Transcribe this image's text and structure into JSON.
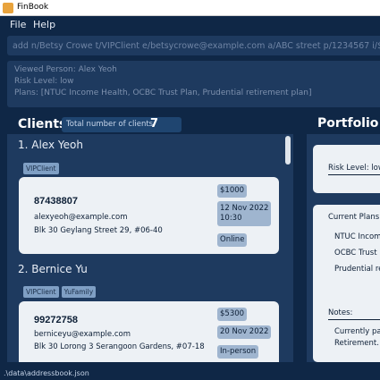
{
  "window": {
    "title": "FinBook"
  },
  "menu": {
    "file": "File",
    "help": "Help"
  },
  "command": {
    "value": "add n/Betsy Crowe t/VIPClient e/betsycrowe@example.com a/ABC street p/1234567 i/$10 m/23 Feb"
  },
  "result": {
    "lines": [
      "Viewed Person: Alex Yeoh",
      "Risk Level: low",
      "Plans: [NTUC Income Health, OCBC Trust Plan, Prudential retirement plan]"
    ]
  },
  "clients": {
    "title": "Clients",
    "count_label": "Total number of clients:",
    "count": "7",
    "items": [
      {
        "index_name": "1.  Alex Yeoh",
        "tags": [
          "VIPClient"
        ],
        "phone": "87438807",
        "email": "alexyeoh@example.com",
        "address": "Blk 30 Geylang Street 29, #06-40",
        "income": "$1000",
        "meeting": "12 Nov 2022\n10:30",
        "meeting_date": "12 Nov 2022",
        "meeting_time": "10:30",
        "mode": "Online"
      },
      {
        "index_name": "2.  Bernice Yu",
        "tags": [
          "VIPClient",
          "YuFamily"
        ],
        "phone": "99272758",
        "email": "berniceyu@example.com",
        "address": "Blk 30 Lorong 3 Serangoon Gardens, #07-18",
        "income": "$5300",
        "meeting_date": "20 Nov 2022",
        "mode": "In-person"
      }
    ]
  },
  "portfolio": {
    "title": "Portfolio",
    "risk": "Risk Level: low",
    "plans_header": "Current Plans:",
    "plans": [
      "NTUC Income Health",
      "OCBC Trust Plan",
      "Prudential retirement plan"
    ],
    "notes_header": "Notes:",
    "notes": [
      "Currently pa",
      "Retirement."
    ]
  },
  "status": {
    "path": ".\\data\\addressbook.json"
  }
}
